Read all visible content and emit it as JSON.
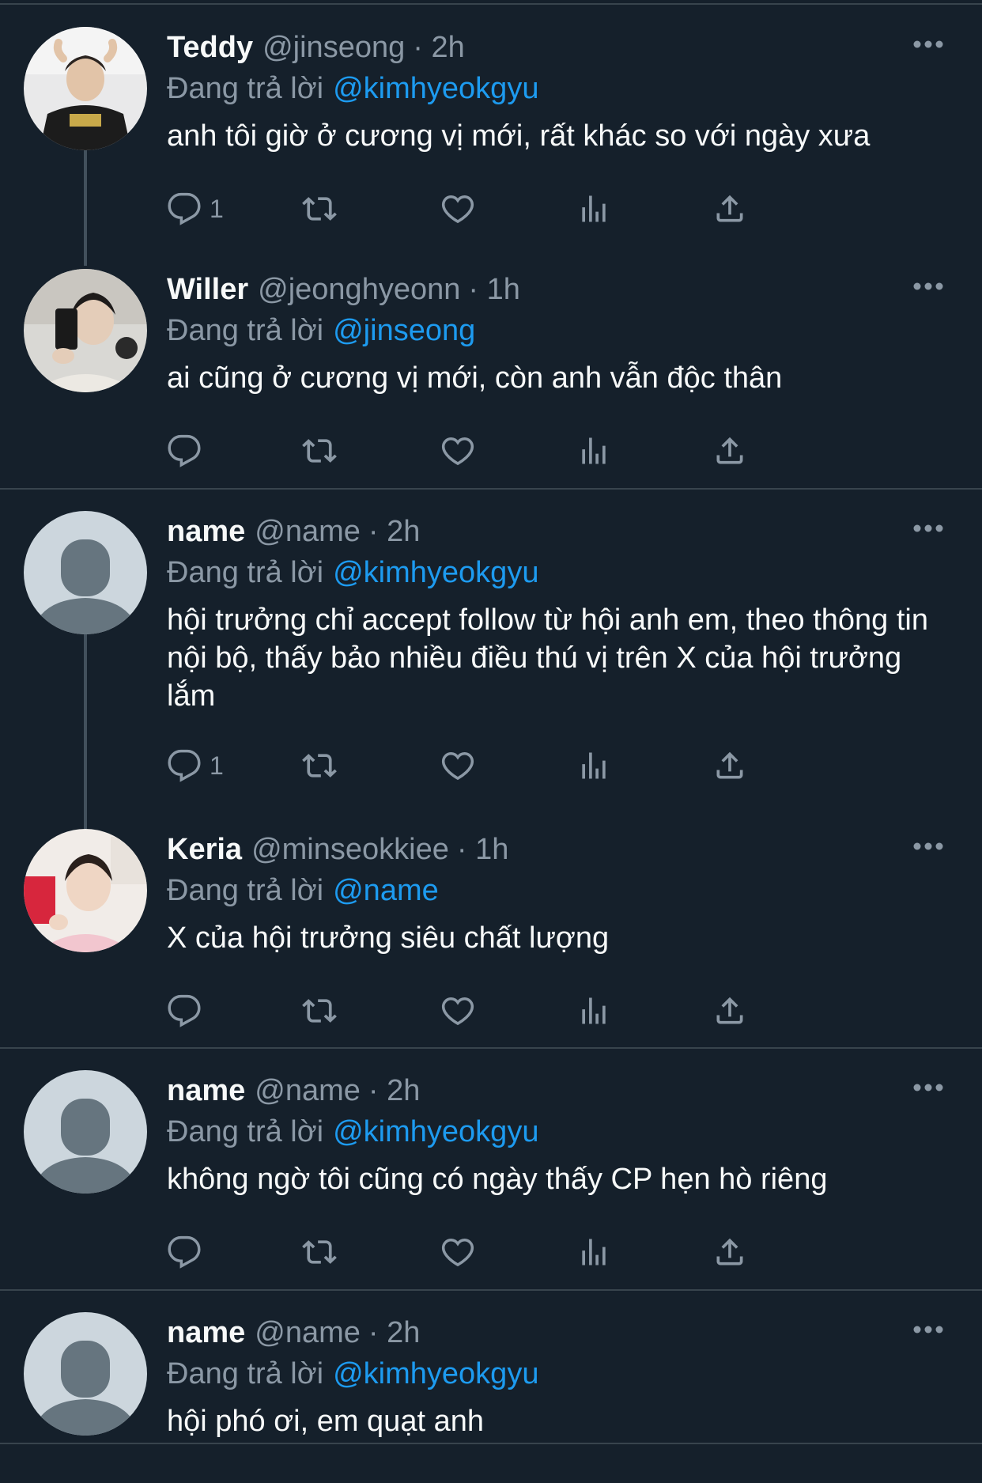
{
  "colors": {
    "background": "#15202b",
    "divider": "#38444d",
    "text": "#f7f9f9",
    "muted": "#8b98a5",
    "accent": "#1d9bf0"
  },
  "tweets": [
    {
      "name": "Teddy",
      "handle": "@jinseong",
      "time": "· 2h",
      "reply_prefix": "Đang trả lời",
      "reply_to": "@kimhyeokgyu",
      "text": "anh tôi giờ ở cương vị mới, rất khác so với ngày xưa",
      "reply_count": "1",
      "avatar": "photo-teddy"
    },
    {
      "name": "Willer",
      "handle": "@jeonghyeonn",
      "time": "· 1h",
      "reply_prefix": "Đang trả lời",
      "reply_to": "@jinseong",
      "text": "ai cũng ở cương vị mới, còn anh vẫn độc thân",
      "reply_count": "",
      "avatar": "photo-willer"
    },
    {
      "name": "name",
      "handle": "@name",
      "time": "· 2h",
      "reply_prefix": "Đang trả lời",
      "reply_to": "@kimhyeokgyu",
      "text": "hội trưởng chỉ accept follow từ hội anh em, theo thông tin nội bộ, thấy bảo nhiều điều thú vị trên X của hội trưởng lắm",
      "reply_count": "1",
      "avatar": "default-user-icon"
    },
    {
      "name": "Keria",
      "handle": "@minseokkiee",
      "time": "· 1h",
      "reply_prefix": "Đang trả lời",
      "reply_to": "@name",
      "text": "X của hội trưởng siêu chất lượng",
      "reply_count": "",
      "avatar": "photo-keria"
    },
    {
      "name": "name",
      "handle": "@name",
      "time": "· 2h",
      "reply_prefix": "Đang trả lời",
      "reply_to": "@kimhyeokgyu",
      "text": "không ngờ tôi cũng có ngày thấy CP hẹn hò riêng",
      "reply_count": "",
      "avatar": "default-user-icon"
    },
    {
      "name": "name",
      "handle": "@name",
      "time": "· 2h",
      "reply_prefix": "Đang trả lời",
      "reply_to": "@kimhyeokgyu",
      "text": "hội phó ơi, em quạt anh",
      "reply_count": "",
      "avatar": "default-user-icon"
    }
  ]
}
